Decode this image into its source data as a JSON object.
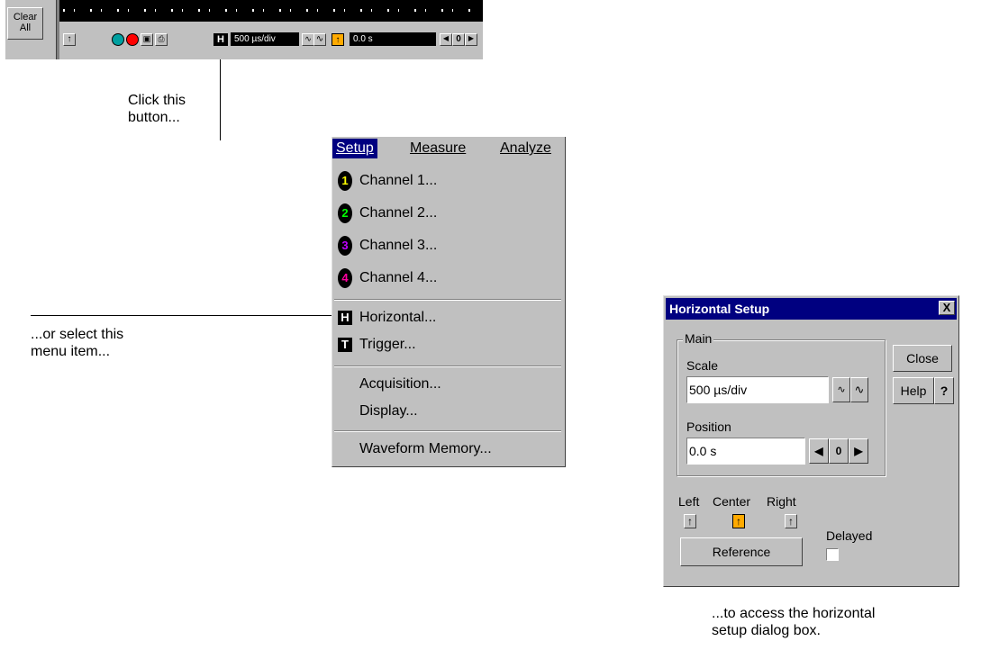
{
  "toolbar": {
    "clear_label": "Clear\nAll",
    "horizontal_badge": "H",
    "timebase_value": "500 µs/div",
    "delay_value": "0.0 s",
    "zero_button": "0"
  },
  "captions": {
    "click_button": "Click this\nbutton...",
    "select_menu": "...or select this\nmenu item...",
    "access_dialog": "...to access the horizontal\nsetup dialog box."
  },
  "menu": {
    "bar": [
      "Setup",
      "Measure",
      "Analyze"
    ],
    "channels": [
      {
        "num": "1",
        "color": "#ffff00",
        "label": "Channel 1..."
      },
      {
        "num": "2",
        "color": "#00ff00",
        "label": "Channel 2..."
      },
      {
        "num": "3",
        "color": "#c000ff",
        "label": "Channel 3..."
      },
      {
        "num": "4",
        "color": "#ff00a0",
        "label": "Channel 4..."
      }
    ],
    "horizontal": {
      "badge": "H",
      "label": "Horizontal..."
    },
    "trigger": {
      "badge": "T",
      "label": "Trigger..."
    },
    "acquisition": "Acquisition...",
    "display": "Display...",
    "waveform_memory": "Waveform Memory..."
  },
  "dialog": {
    "title": "Horizontal Setup",
    "close_x": "X",
    "group_label": "Main",
    "scale_label": "Scale",
    "scale_value": "500 µs/div",
    "position_label": "Position",
    "position_value": "0.0 s",
    "zero_button": "0",
    "close_button": "Close",
    "help_button": "Help",
    "help_pointer": "?",
    "reference_labels": [
      "Left",
      "Center",
      "Right"
    ],
    "reference_button": "Reference",
    "delayed_label": "Delayed",
    "reference_active_color": "#ffaa00"
  }
}
